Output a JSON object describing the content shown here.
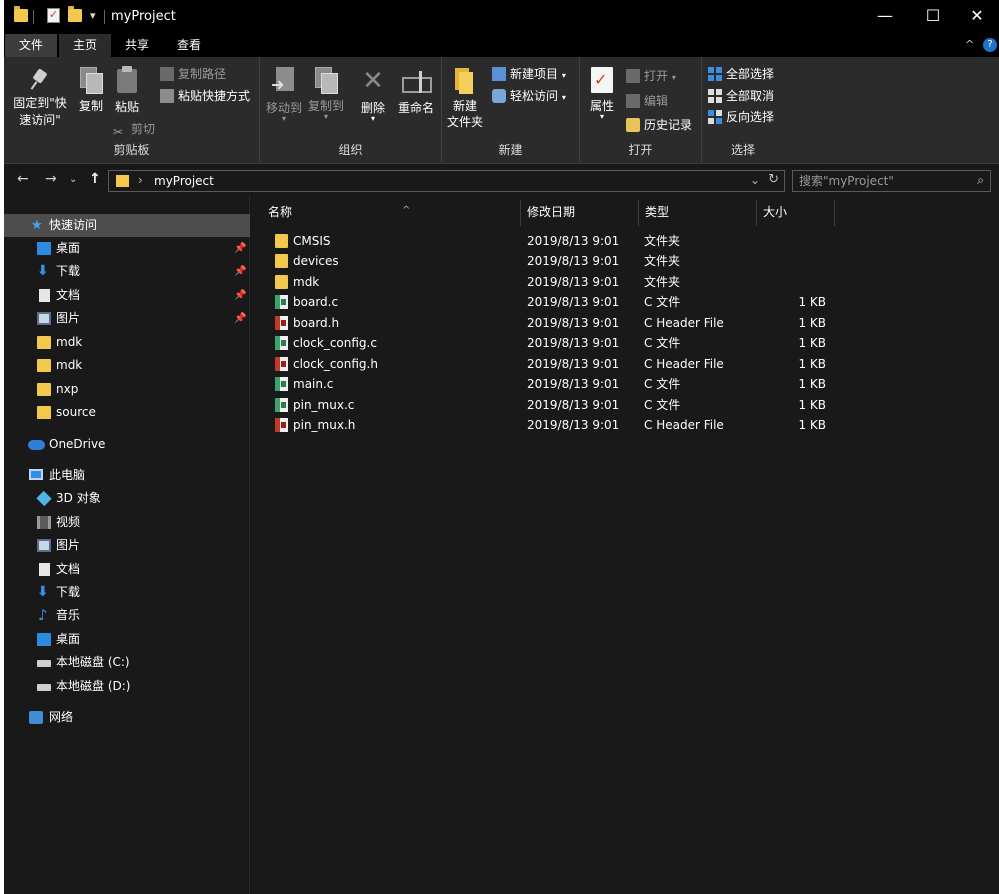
{
  "window": {
    "title": "myProject",
    "controls": {
      "minimize": "—",
      "maximize": "☐",
      "close": "✕"
    }
  },
  "ribbon_tabs": [
    "文件",
    "主页",
    "共享",
    "查看"
  ],
  "ribbon": {
    "clipboard": {
      "label": "剪贴板",
      "pin_quick": "固定到\"快速访问\"",
      "copy": "复制",
      "paste": "粘贴",
      "copy_path": "复制路径",
      "paste_shortcut": "粘贴快捷方式",
      "cut": "剪切"
    },
    "organize": {
      "label": "组织",
      "move_to": "移动到",
      "copy_to": "复制到",
      "delete": "删除",
      "rename": "重命名"
    },
    "new": {
      "label": "新建",
      "new_folder": "新建\n文件夹",
      "new_item": "新建项目",
      "easy_access": "轻松访问"
    },
    "open": {
      "label": "打开",
      "properties": "属性",
      "open": "打开",
      "edit": "编辑",
      "history": "历史记录"
    },
    "select": {
      "label": "选择",
      "select_all": "全部选择",
      "select_none": "全部取消",
      "invert": "反向选择"
    }
  },
  "address": {
    "path": "myProject",
    "search_placeholder": "搜索\"myProject\""
  },
  "sidebar": {
    "quick_access": "快速访问",
    "quick_items": [
      {
        "label": "桌面",
        "icon": "desktop-icon",
        "pinned": true
      },
      {
        "label": "下载",
        "icon": "download-icon",
        "pinned": true
      },
      {
        "label": "文档",
        "icon": "document-icon",
        "pinned": true
      },
      {
        "label": "图片",
        "icon": "picture-icon",
        "pinned": true
      },
      {
        "label": "mdk",
        "icon": "folder-icon",
        "pinned": false
      },
      {
        "label": "mdk",
        "icon": "folder-icon",
        "pinned": false
      },
      {
        "label": "nxp",
        "icon": "folder-icon",
        "pinned": false
      },
      {
        "label": "source",
        "icon": "folder-icon",
        "pinned": false
      }
    ],
    "onedrive": "OneDrive",
    "this_pc": "此电脑",
    "pc_items": [
      {
        "label": "3D 对象",
        "icon": "3d-objects-icon"
      },
      {
        "label": "视频",
        "icon": "video-icon"
      },
      {
        "label": "图片",
        "icon": "picture-icon"
      },
      {
        "label": "文档",
        "icon": "document-icon"
      },
      {
        "label": "下载",
        "icon": "download-icon"
      },
      {
        "label": "音乐",
        "icon": "music-icon"
      },
      {
        "label": "桌面",
        "icon": "desktop-icon"
      },
      {
        "label": "本地磁盘 (C:)",
        "icon": "drive-icon"
      },
      {
        "label": "本地磁盘 (D:)",
        "icon": "drive-icon"
      }
    ],
    "network": "网络"
  },
  "file_list": {
    "columns": {
      "name": "名称",
      "modified": "修改日期",
      "type": "类型",
      "size": "大小"
    },
    "files": [
      {
        "name": "CMSIS",
        "modified": "2019/8/13 9:01",
        "type": "文件夹",
        "size": "",
        "kind": "folder"
      },
      {
        "name": "devices",
        "modified": "2019/8/13 9:01",
        "type": "文件夹",
        "size": "",
        "kind": "folder"
      },
      {
        "name": "mdk",
        "modified": "2019/8/13 9:01",
        "type": "文件夹",
        "size": "",
        "kind": "folder"
      },
      {
        "name": "board.c",
        "modified": "2019/8/13 9:01",
        "type": "C 文件",
        "size": "1 KB",
        "kind": "c"
      },
      {
        "name": "board.h",
        "modified": "2019/8/13 9:01",
        "type": "C Header File",
        "size": "1 KB",
        "kind": "h"
      },
      {
        "name": "clock_config.c",
        "modified": "2019/8/13 9:01",
        "type": "C 文件",
        "size": "1 KB",
        "kind": "c"
      },
      {
        "name": "clock_config.h",
        "modified": "2019/8/13 9:01",
        "type": "C Header File",
        "size": "1 KB",
        "kind": "h"
      },
      {
        "name": "main.c",
        "modified": "2019/8/13 9:01",
        "type": "C 文件",
        "size": "1 KB",
        "kind": "c"
      },
      {
        "name": "pin_mux.c",
        "modified": "2019/8/13 9:01",
        "type": "C 文件",
        "size": "1 KB",
        "kind": "c"
      },
      {
        "name": "pin_mux.h",
        "modified": "2019/8/13 9:01",
        "type": "C Header File",
        "size": "1 KB",
        "kind": "h"
      }
    ]
  },
  "colors": {
    "background": "#191919",
    "ribbon": "#2b2b2b",
    "folder": "#f2c94c",
    "selected": "#4d4d4d",
    "accent": "#2c8be0"
  }
}
